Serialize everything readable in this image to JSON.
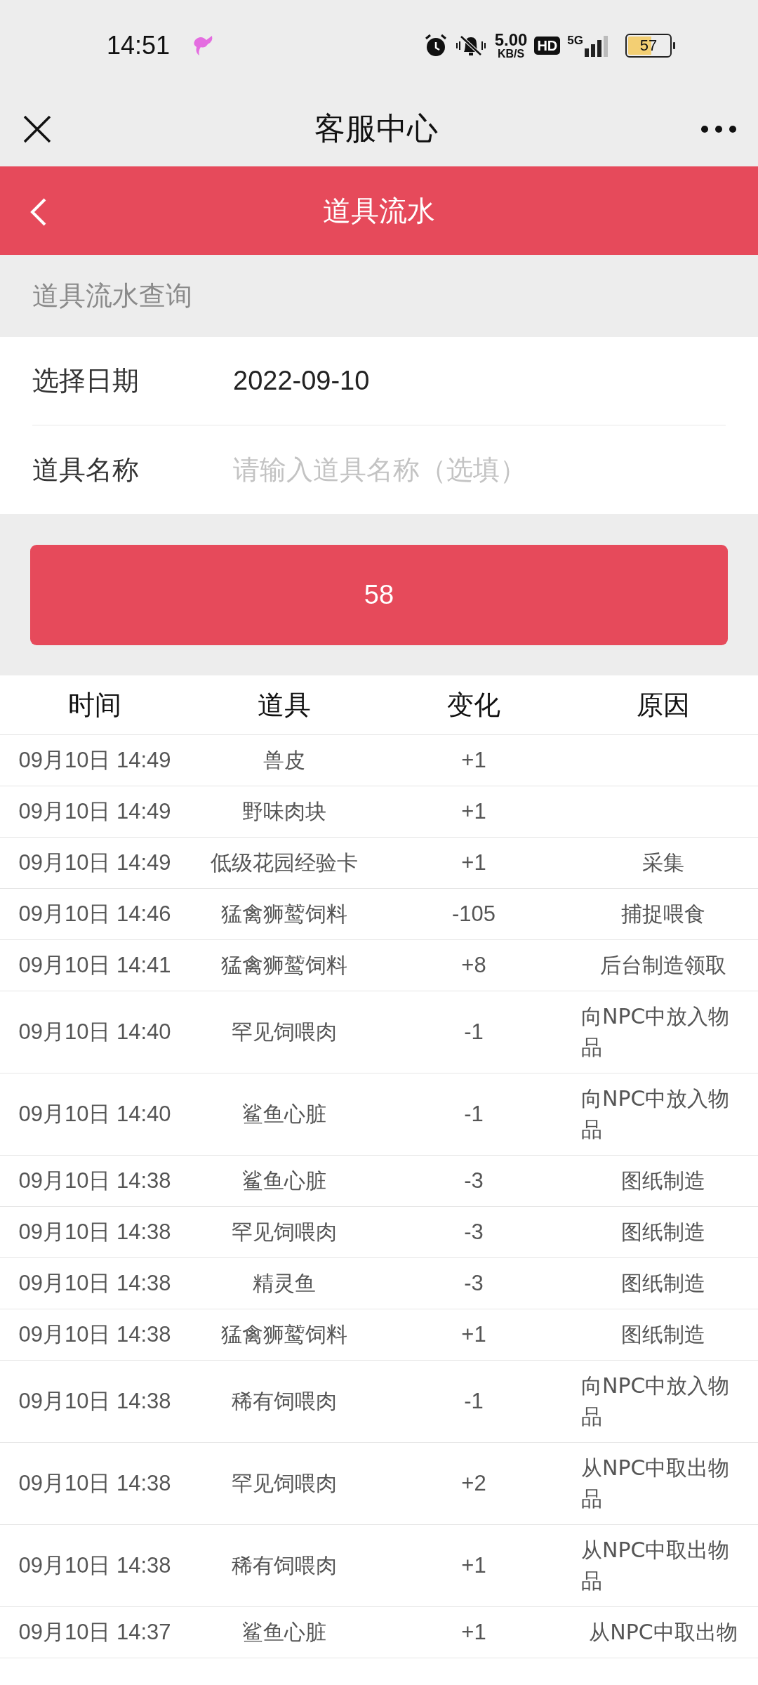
{
  "status_bar": {
    "time": "14:51",
    "speed": "5.00",
    "speed_unit": "KB/S",
    "hd": "HD",
    "network": "5G",
    "battery": "57"
  },
  "nav": {
    "title": "客服中心"
  },
  "header": {
    "title": "道具流水"
  },
  "section_label": "道具流水查询",
  "form": {
    "date": {
      "label": "选择日期",
      "value": "2022-09-10"
    },
    "item": {
      "label": "道具名称",
      "placeholder": "请输入道具名称（选填）"
    }
  },
  "button": {
    "label": "58"
  },
  "table": {
    "columns": [
      "时间",
      "道具",
      "变化",
      "原因"
    ],
    "rows": [
      {
        "time": "09月10日 14:49",
        "item": "兽皮",
        "change": "+1"
      },
      {
        "time": "09月10日 14:49",
        "item": "野味肉块",
        "change": "+1"
      },
      {
        "time": "09月10日 14:49",
        "item": "低级花园经验卡",
        "change": "+1",
        "reason": "采集"
      },
      {
        "time": "09月10日 14:46",
        "item": "猛禽狮鹫饲料",
        "change": "-105",
        "reason": "捕捉喂食"
      },
      {
        "time": "09月10日 14:41",
        "item": "猛禽狮鹫饲料",
        "change": "+8",
        "reason": "后台制造领取"
      },
      {
        "time": "09月10日 14:40",
        "item": "罕见饲喂肉",
        "change": "-1",
        "reason": "向NPC中放入物品"
      },
      {
        "time": "09月10日 14:40",
        "item": "鲨鱼心脏",
        "change": "-1",
        "reason": "向NPC中放入物品"
      },
      {
        "time": "09月10日 14:38",
        "item": "鲨鱼心脏",
        "change": "-3",
        "reason": "图纸制造"
      },
      {
        "time": "09月10日 14:38",
        "item": "罕见饲喂肉",
        "change": "-3",
        "reason": "图纸制造"
      },
      {
        "time": "09月10日 14:38",
        "item": "精灵鱼",
        "change": "-3",
        "reason": "图纸制造"
      },
      {
        "time": "09月10日 14:38",
        "item": "猛禽狮鹫饲料",
        "change": "+1",
        "reason": "图纸制造"
      },
      {
        "time": "09月10日 14:38",
        "item": "稀有饲喂肉",
        "change": "-1",
        "reason": "向NPC中放入物品"
      },
      {
        "time": "09月10日 14:38",
        "item": "罕见饲喂肉",
        "change": "+2",
        "reason": "从NPC中取出物品"
      },
      {
        "time": "09月10日 14:38",
        "item": "稀有饲喂肉",
        "change": "+1",
        "reason": "从NPC中取出物品"
      },
      {
        "time": "09月10日 14:37",
        "item": "鲨鱼心脏",
        "change": "+1",
        "reason": "从NPC中取出物"
      }
    ]
  }
}
